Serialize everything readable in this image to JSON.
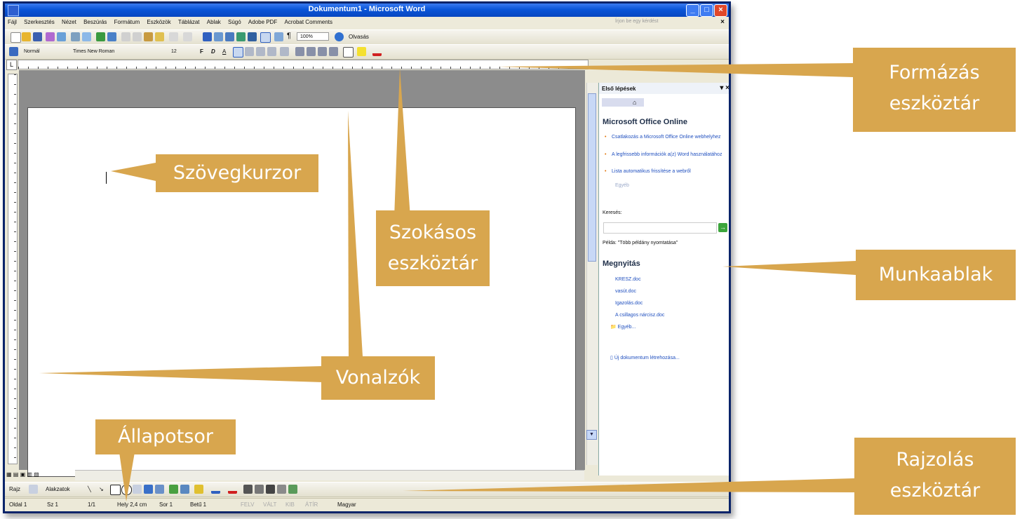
{
  "window": {
    "title": "Dokumentum1 - Microsoft Word",
    "menu": [
      "Fájl",
      "Szerkesztés",
      "Nézet",
      "Beszúrás",
      "Formátum",
      "Eszközök",
      "Táblázat",
      "Ablak",
      "Súgó",
      "Adobe PDF",
      "Acrobat Comments"
    ],
    "help_placeholder": "Írjon be egy kérdést",
    "zoom": "100%",
    "read_label": "Olvasás"
  },
  "format_toolbar": {
    "style": "Normál",
    "font": "Times New Roman",
    "size": "12"
  },
  "task_pane": {
    "title": "Első lépések",
    "online_heading": "Microsoft Office Online",
    "online_links": [
      "Csatlakozás a Microsoft Office Online webhelyhez",
      "A legfrissebb információk a(z) Word használatához",
      "Lista automatikus frissítése a webről"
    ],
    "more": "Egyéb",
    "search_label": "Keresés:",
    "example": "Példa: \"Több példány nyomtatása\"",
    "open_heading": "Megnyitás",
    "recent_files": [
      "KRESZ.doc",
      "vasút.doc",
      "Igazolás.doc",
      "A csillagos nárcisz.doc"
    ],
    "more_files": "Egyéb...",
    "new_document": "Új dokumentum létrehozása..."
  },
  "drawing_toolbar": {
    "draw_label": "Rajz",
    "autoshapes_label": "Alakzatok"
  },
  "status_bar": {
    "page": "Oldal 1",
    "section": "Sz 1",
    "pages": "1/1",
    "position": "Hely 2,4 cm",
    "line": "Sor 1",
    "column": "Betű 1",
    "rec": "FELV",
    "trk": "VÁLT",
    "ext": "KIB",
    "ovr": "ÁTÍR",
    "language": "Magyar"
  },
  "callouts": {
    "formatting": [
      "Formázás",
      "eszköztár"
    ],
    "cursor": "Szövegkurzor",
    "standard": [
      "Szokásos",
      "eszköztár"
    ],
    "taskpane": "Munkaablak",
    "rulers": "Vonalzók",
    "statusbar": "Állapotsor",
    "drawing": [
      "Rajzolás",
      "eszköztár"
    ]
  },
  "colors": {
    "callout": "#d8a64e",
    "titlebar": "#0a55d8",
    "link": "#1f4fbf"
  }
}
